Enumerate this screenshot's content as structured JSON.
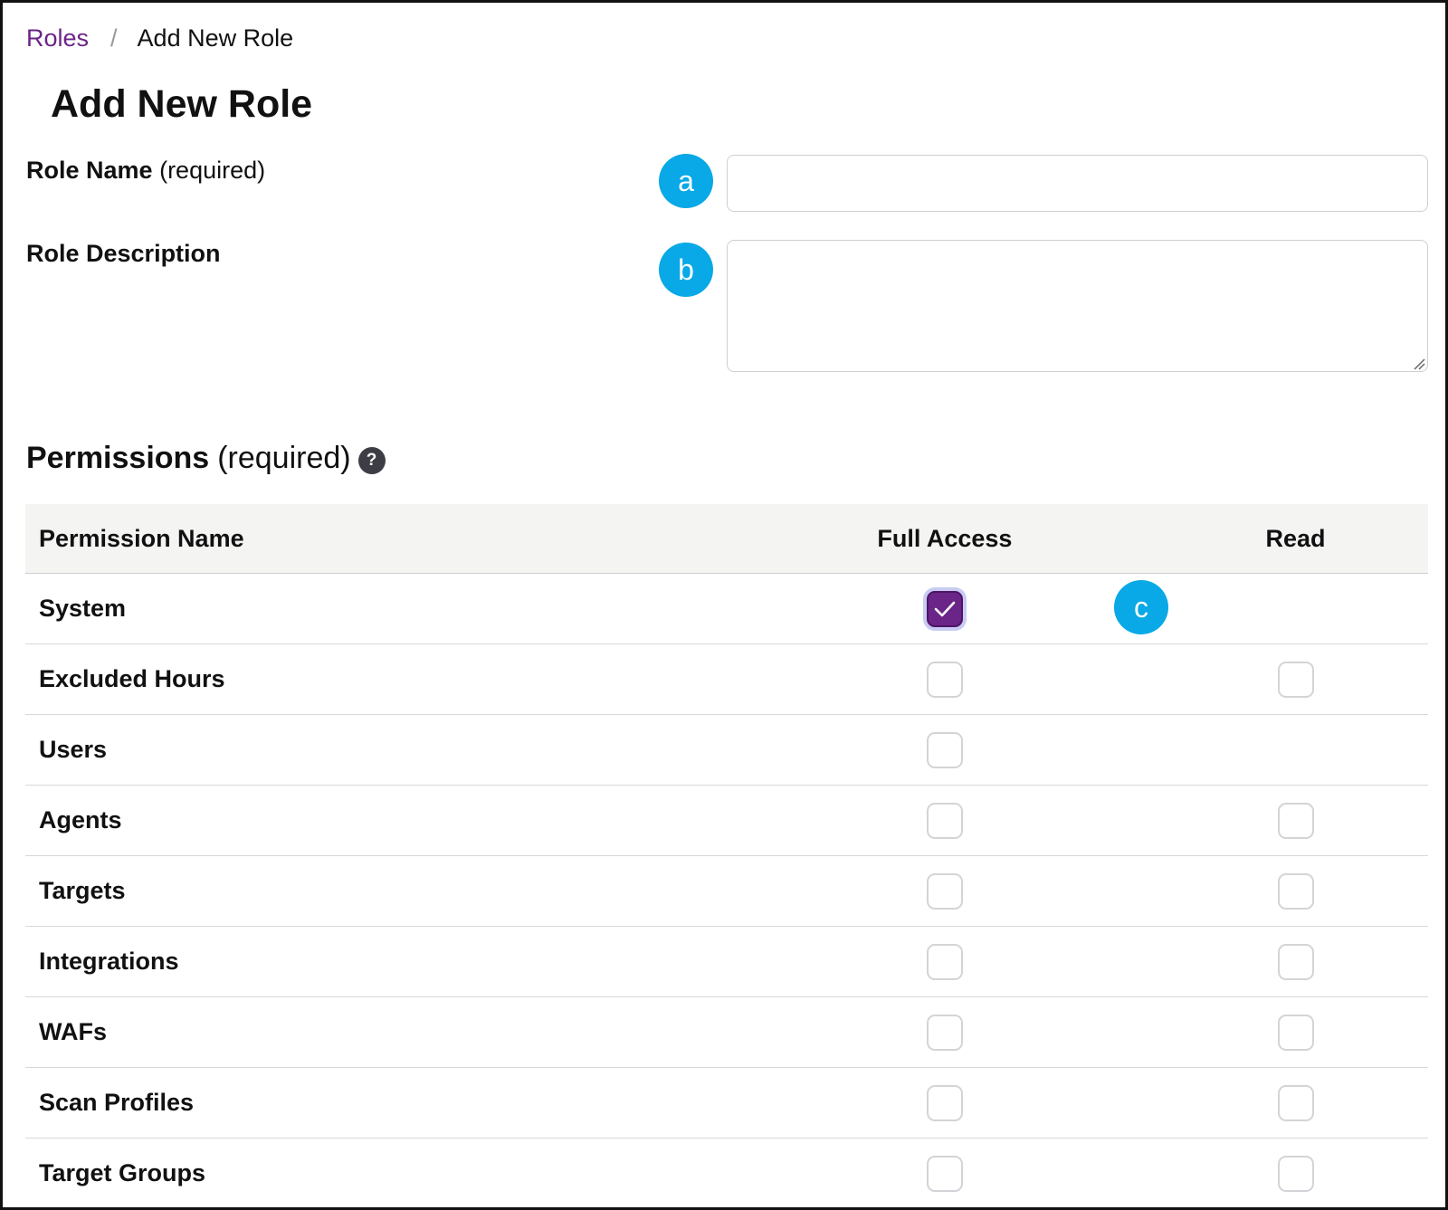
{
  "breadcrumb": {
    "parent": "Roles",
    "separator": "/",
    "current": "Add New Role"
  },
  "page_title": "Add New Role",
  "form": {
    "role_name": {
      "label": "Role Name",
      "qualifier": "(required)",
      "value": "",
      "callout": "a"
    },
    "role_description": {
      "label": "Role Description",
      "value": "",
      "callout": "b"
    }
  },
  "permissions": {
    "heading": "Permissions",
    "qualifier": "(required)",
    "help_icon_text": "?",
    "callout": "c",
    "columns": {
      "name": "Permission Name",
      "full": "Full Access",
      "read": "Read"
    },
    "rows": [
      {
        "name": "System",
        "full": true,
        "read": null
      },
      {
        "name": "Excluded Hours",
        "full": false,
        "read": false
      },
      {
        "name": "Users",
        "full": false,
        "read": null
      },
      {
        "name": "Agents",
        "full": false,
        "read": false
      },
      {
        "name": "Targets",
        "full": false,
        "read": false
      },
      {
        "name": "Integrations",
        "full": false,
        "read": false
      },
      {
        "name": "WAFs",
        "full": false,
        "read": false
      },
      {
        "name": "Scan Profiles",
        "full": false,
        "read": false
      },
      {
        "name": "Target Groups",
        "full": false,
        "read": false
      }
    ]
  },
  "colors": {
    "accent": "#6b2487",
    "callout": "#09a8e6"
  }
}
